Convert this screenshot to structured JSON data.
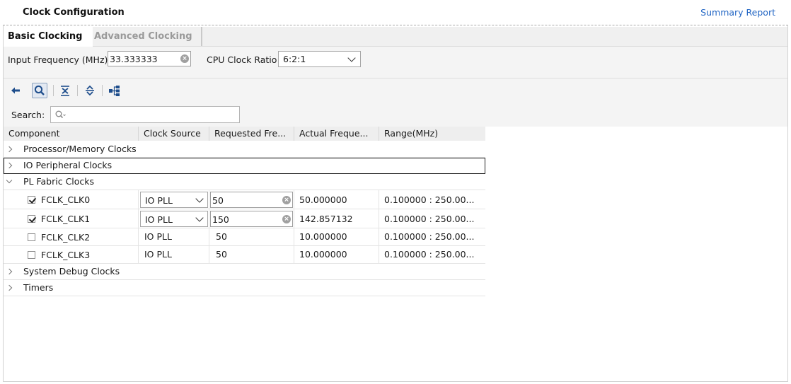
{
  "header": {
    "title": "Clock Configuration",
    "summary_link": "Summary Report"
  },
  "tabs": [
    {
      "label": "Basic Clocking",
      "active": true
    },
    {
      "label": "Advanced Clocking",
      "active": false
    }
  ],
  "form": {
    "input_freq_label": "Input Frequency (MHz)",
    "input_freq_value": "33.333333",
    "cpu_ratio_label": "CPU Clock Ratio",
    "cpu_ratio_value": "6:2:1"
  },
  "toolbar": {
    "icons": [
      "back-arrow-icon",
      "search-icon",
      "collapse-all-icon",
      "expand-all-icon",
      "hierarchy-icon"
    ]
  },
  "search": {
    "label": "Search:",
    "value": ""
  },
  "table": {
    "columns": [
      "Component",
      "Clock Source",
      "Requested Fre...",
      "Actual Freque...",
      "Range(MHz)"
    ],
    "groups": {
      "processor": "Processor/Memory Clocks",
      "io": "IO Peripheral Clocks",
      "pl": "PL Fabric Clocks",
      "debug": "System Debug Clocks",
      "timers": "Timers"
    },
    "rows": [
      {
        "name": "FCLK_CLK0",
        "checked": true,
        "source": "IO PLL",
        "requested": "50",
        "actual": "50.000000",
        "range": "0.100000 : 250.00..."
      },
      {
        "name": "FCLK_CLK1",
        "checked": true,
        "source": "IO PLL",
        "requested": "150",
        "actual": "142.857132",
        "range": "0.100000 : 250.00..."
      },
      {
        "name": "FCLK_CLK2",
        "checked": false,
        "source": "IO PLL",
        "requested": "50",
        "actual": "10.000000",
        "range": "0.100000 : 250.00..."
      },
      {
        "name": "FCLK_CLK3",
        "checked": false,
        "source": "IO PLL",
        "requested": "50",
        "actual": "10.000000",
        "range": "0.100000 : 250.00..."
      }
    ]
  },
  "colors": {
    "link": "#2266c4",
    "selected_tool": "#e3e9f2",
    "focus_border": "#222222"
  }
}
